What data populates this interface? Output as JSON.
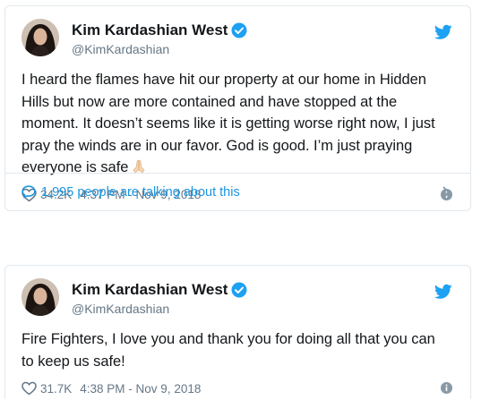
{
  "tweets": [
    {
      "display_name": "Kim Kardashian West",
      "handle": "@KimKardashian",
      "text": "I heard the flames have hit our property at our home in Hidden Hills but now are more contained and have stopped at the moment. It doesn’t seems like it is getting worse right now, I just pray the winds are in our favor. God is good. I’m just praying everyone is safe",
      "emoji": "praying-hands-icon",
      "likes": "34.2K",
      "timestamp": "4:37 PM - Nov 9, 2018",
      "talking": "1,995 people are talking about this"
    },
    {
      "display_name": "Kim Kardashian West",
      "handle": "@KimKardashian",
      "text": "Fire Fighters, I love you and thank you for doing all that you can to keep us safe!",
      "likes": "31.7K",
      "timestamp": "4:38 PM - Nov 9, 2018"
    }
  ],
  "icons": [
    "verified-icon",
    "twitter-bird-icon",
    "heart-icon",
    "info-icon",
    "speech-bubble-icon",
    "chevron-right-icon",
    "praying-hands-icon"
  ],
  "colors": {
    "accent": "#1da1f2",
    "link": "#1b95e0",
    "text": "#14171a",
    "muted": "#657786",
    "border": "#e1e8ed"
  }
}
